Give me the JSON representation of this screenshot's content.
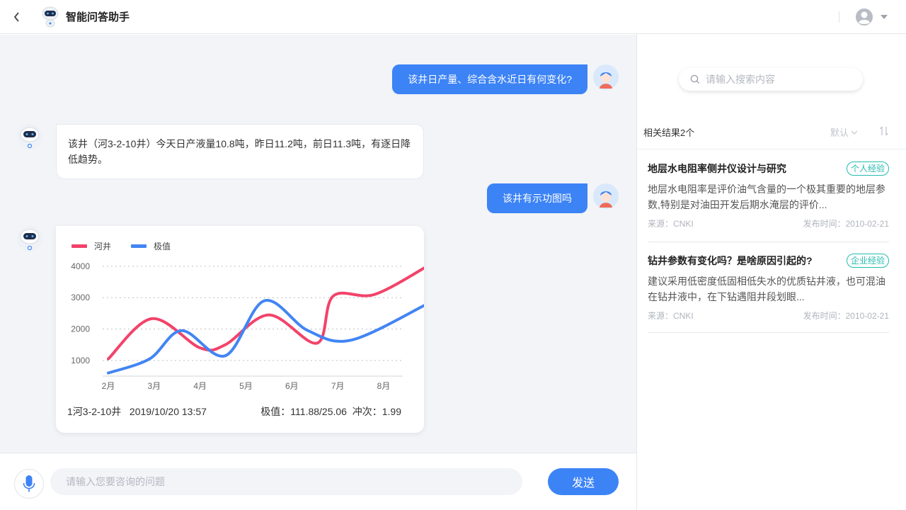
{
  "header": {
    "title": "智能问答助手",
    "icons": {
      "back": "back-arrow-icon",
      "logo": "robot-logo-icon",
      "avatar": "user-avatar-icon",
      "caret": "caret-down-icon"
    }
  },
  "messages": [
    {
      "role": "user",
      "text": "该井日产量、综合含水近日有何变化?"
    },
    {
      "role": "bot",
      "text": "该井（河3-2-10井）今天日产液量10.8吨，昨日11.2吨，前日11.3吨，有逐日降低趋势。"
    },
    {
      "role": "user",
      "text": "该井有示功图吗"
    }
  ],
  "chart_card": {
    "footer_left": "1河3-2-10井   2019/10/20 13:57",
    "footer_right": "极值：111.88/25.06  冲次：1.99"
  },
  "chart_data": {
    "type": "line",
    "categories": [
      "2月",
      "3月",
      "4月",
      "5月",
      "6月",
      "7月",
      "8月"
    ],
    "yticks": [
      1000,
      2000,
      3000,
      4000
    ],
    "ylim": [
      500,
      4200
    ],
    "grid": true,
    "legend_position": "top-left",
    "series": [
      {
        "name": "河井",
        "color": "#f2436a",
        "x": [
          0,
          0.95,
          2.0,
          2.55,
          3.5,
          4.55,
          4.9,
          5.8,
          6.95
        ],
        "y": [
          1050,
          2330,
          1400,
          1500,
          2450,
          1550,
          3050,
          3100,
          4000
        ]
      },
      {
        "name": "极值",
        "color": "#4285f4",
        "x": [
          0,
          0.9,
          1.6,
          2.55,
          3.4,
          4.35,
          5.3,
          6.95
        ],
        "y": [
          600,
          1050,
          1950,
          1150,
          2900,
          1950,
          1650,
          2800
        ]
      }
    ]
  },
  "input_bar": {
    "placeholder": "请输入您要咨询的问题",
    "send_label": "发送",
    "mic_icon": "microphone-icon"
  },
  "side_panel": {
    "search_placeholder": "请输入搜索内容",
    "results_count": "相关结果2个",
    "sort_label": "默认",
    "results": [
      {
        "title": "地层水电阻率侧井仪设计与研究",
        "tag": "个人经验",
        "desc": "地层水电阻率是评价油气含量的一个极其重要的地层参数,特别是对油田开发后期水淹层的评价...",
        "source": "来源：CNKI",
        "date": "发布时间：2010-02-21"
      },
      {
        "title": "钻井参数有变化吗？是啥原因引起的?",
        "tag": "企业经验",
        "desc": "建议采用低密度低固相低失水的优质钻井液，也可混油在钻井液中，在下钻遇阻井段划眼...",
        "source": "来源：CNKI",
        "date": "发布时间：2010-02-21"
      }
    ]
  }
}
